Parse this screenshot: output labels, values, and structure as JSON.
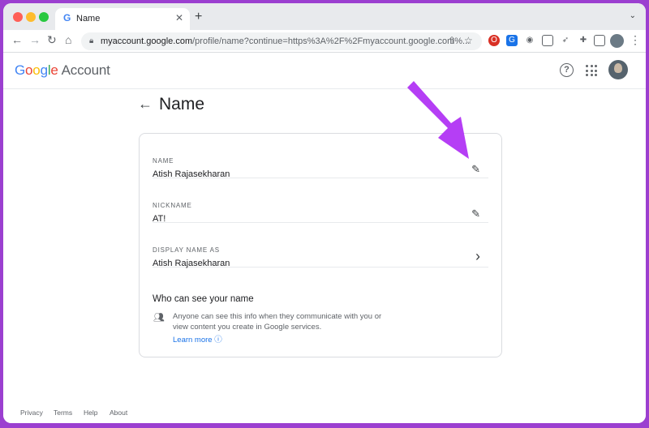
{
  "browser": {
    "tab_title": "Name",
    "new_tab": "+",
    "tab_close": "✕",
    "tab_menu": "⌄",
    "url_host": "myaccount.google.com",
    "url_rest": "/profile/name?continue=https%3A%2F%2Fmyaccount.google.com%...",
    "back": "←",
    "forward": "→",
    "reload": "↻",
    "home": "⌂",
    "share": "⇧",
    "bookmark": "☆",
    "menu": "⋮"
  },
  "header": {
    "logo_google": "Google",
    "logo_account": "Account",
    "help": "?"
  },
  "main": {
    "back_arrow": "←",
    "title": "Name",
    "rows": [
      {
        "label": "NAME",
        "value": "Atish Rajasekharan",
        "action": "✎"
      },
      {
        "label": "NICKNAME",
        "value": "AT!",
        "action": "✎"
      },
      {
        "label": "DISPLAY NAME AS",
        "value": "Atish Rajasekharan",
        "action": "›"
      }
    ],
    "who_title": "Who can see your name",
    "who_text": "Anyone can see this info when they communicate with you or view content you create in Google services.",
    "learn_more": "Learn more ⓘ"
  },
  "footer": {
    "privacy": "Privacy",
    "terms": "Terms",
    "help": "Help",
    "about": "About"
  },
  "colors": {
    "accent": "#9b3fd0",
    "link": "#1a73e8",
    "annotation_arrow": "#b53ef5"
  }
}
